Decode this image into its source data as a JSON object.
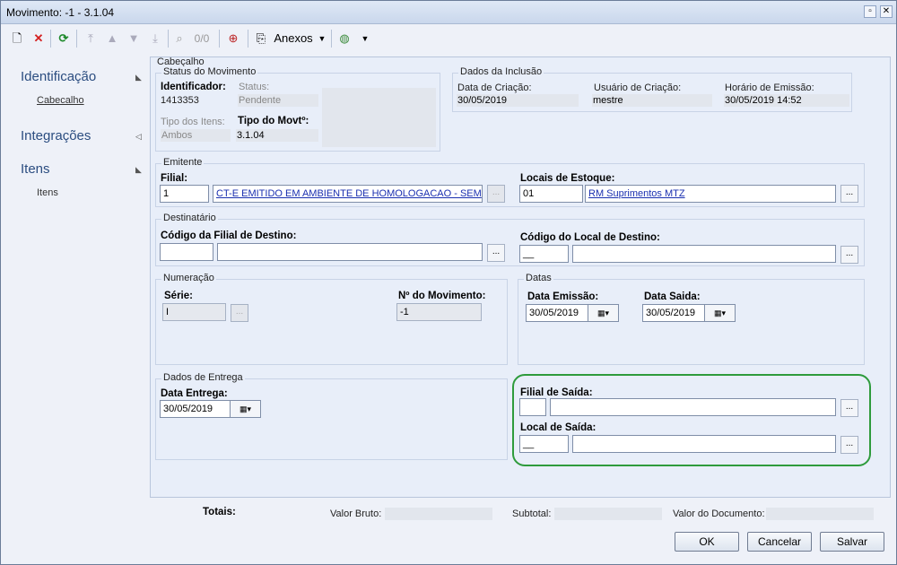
{
  "window": {
    "title": "Movimento: -1 - 3.1.04",
    "restore": "▫",
    "close": "✕"
  },
  "toolbar": {
    "nav_count": "0/0",
    "anexos": "Anexos",
    "icons": [
      "new-doc-icon",
      "delete-icon",
      "refresh-icon",
      "first-icon",
      "prev-icon",
      "next-icon",
      "last-icon",
      "binoculars-icon",
      "zoom-icon",
      "attach-icon",
      "globe-icon"
    ]
  },
  "nav": {
    "identificacao": "Identificação",
    "cabecalho": "Cabecalho",
    "integracoes": "Integrações",
    "itens": "Itens",
    "itens_sub": "Itens"
  },
  "cabecalho": {
    "legend": "Cabeçalho",
    "status": {
      "legend": "Status do Movimento",
      "identificador_label": "Identificador:",
      "identificador": "1413353",
      "status_label": "Status:",
      "status": "Pendente",
      "tipo_itens_label": "Tipo dos Itens:",
      "tipo_itens": "Ambos",
      "tipo_movto_label": "Tipo do Movtº:",
      "tipo_movto": "3.1.04"
    },
    "inclusao": {
      "legend": "Dados da Inclusão",
      "data_criacao_label": "Data de Criação:",
      "data_criacao": "30/05/2019",
      "usuario_label": "Usuário de Criação:",
      "usuario": "mestre",
      "horario_label": "Horário de Emissão:",
      "horario": "30/05/2019 14:52"
    }
  },
  "emitente": {
    "legend": "Emitente",
    "filial_label": "Filial:",
    "filial_code": "1",
    "filial_name": "CT-E EMITIDO EM AMBIENTE DE HOMOLOGACAO - SEM",
    "locais_label": "Locais de Estoque:",
    "local_code": "01",
    "local_name": "RM Suprimentos MTZ"
  },
  "destinatario": {
    "legend": "Destinatário",
    "filial_label": "Código da Filial de Destino:",
    "local_label": "Código do Local de Destino:",
    "local_code": "__"
  },
  "numeracao": {
    "legend": "Numeração",
    "serie_label": "Série:",
    "serie": "I",
    "nmov_label": "Nº do Movimento:",
    "nmov": "-1"
  },
  "datas": {
    "legend": "Datas",
    "emissao_label": "Data Emissão:",
    "emissao": "30/05/2019",
    "saida_label": "Data Saida:",
    "saida": "30/05/2019"
  },
  "entrega": {
    "legend": "Dados de Entrega",
    "data_label": "Data Entrega:",
    "data": "30/05/2019"
  },
  "saida": {
    "filial_label": "Filial de Saída:",
    "local_label": "Local de Saída:",
    "local_code": "__"
  },
  "totais": {
    "label": "Totais:",
    "valor_bruto": "Valor Bruto:",
    "subtotal": "Subtotal:",
    "valor_documento": "Valor do Documento:"
  },
  "buttons": {
    "ok": "OK",
    "cancelar": "Cancelar",
    "salvar": "Salvar",
    "ellipsis": "...",
    "dropdown": "▦▾"
  }
}
